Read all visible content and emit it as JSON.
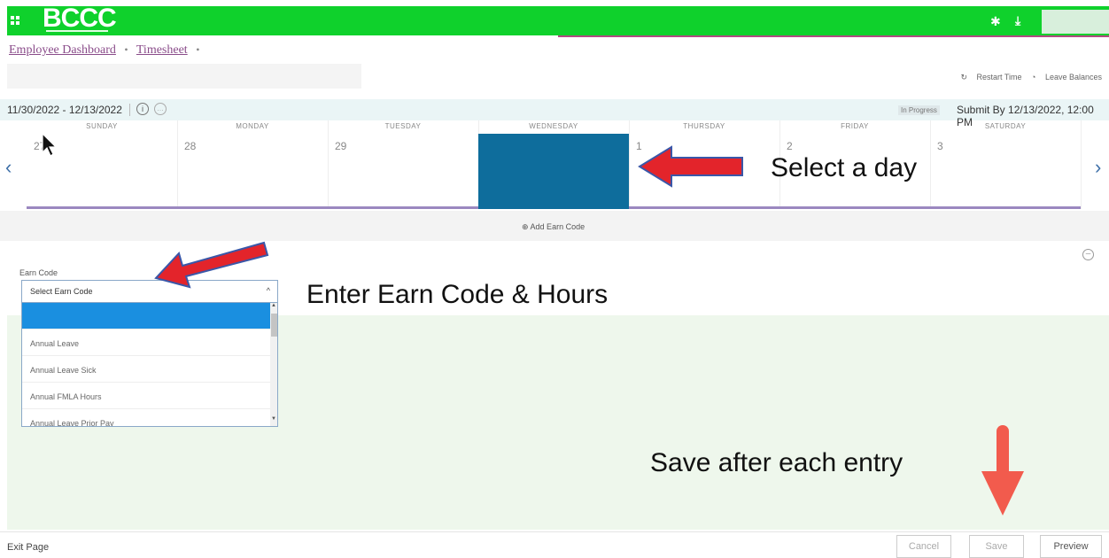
{
  "header": {
    "logo": "BCCC"
  },
  "breadcrumb": {
    "items": [
      "Employee Dashboard",
      "Timesheet"
    ]
  },
  "top_actions": {
    "restart": "Restart Time",
    "leave_balances": "Leave Balances"
  },
  "period": {
    "range": "11/30/2022 - 12/13/2022",
    "status": "In Progress",
    "submit_by": "Submit By 12/13/2022, 12:00 PM"
  },
  "week": {
    "days": [
      {
        "name": "SUNDAY",
        "num": "27"
      },
      {
        "name": "MONDAY",
        "num": "28"
      },
      {
        "name": "TUESDAY",
        "num": "29"
      },
      {
        "name": "WEDNESDAY",
        "num": ""
      },
      {
        "name": "THURSDAY",
        "num": "1"
      },
      {
        "name": "FRIDAY",
        "num": "2"
      },
      {
        "name": "SATURDAY",
        "num": "3"
      }
    ],
    "selected_index": 3
  },
  "add_earn_code": "Add Earn Code",
  "earn": {
    "label": "Earn Code",
    "select_value": "Select Earn Code",
    "options": [
      "",
      "Annual Leave",
      "Annual Leave Sick",
      "Annual FMLA Hours",
      "Annual Leave Prior Pay"
    ]
  },
  "annotations": {
    "select_day": "Select a day",
    "enter_earn": "Enter Earn Code & Hours",
    "save_after": "Save after each entry"
  },
  "footer": {
    "exit": "Exit Page",
    "cancel": "Cancel",
    "save": "Save",
    "preview": "Preview"
  },
  "colors": {
    "header_green": "#0fd12c",
    "selected_day": "#0e6d9c",
    "dropdown_highlight": "#1a8fe0",
    "arrow_red": "#e3242b",
    "down_arrow": "#f25b4d"
  }
}
